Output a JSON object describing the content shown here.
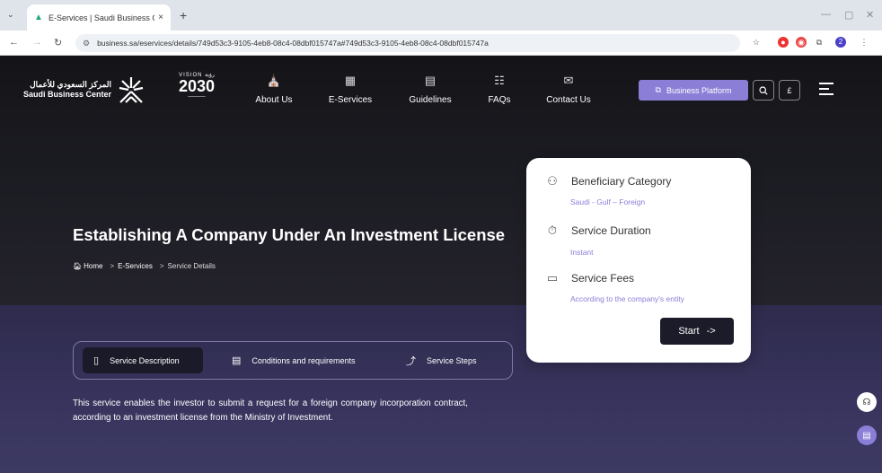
{
  "browser": {
    "tab_title": "E-Services | Saudi Business Cen",
    "tab_close": "×",
    "new_tab": "+",
    "url": "business.sa/eservices/details/749d53c3-9105-4eb8-08c4-08dbf015747a#749d53c3-9105-4eb8-08c4-08dbf015747a",
    "profile_initial": "2"
  },
  "header": {
    "logo_arabic": "المركز السعودي للأعمال",
    "logo_english": "Saudi Business Center",
    "vision_top": "VISION رؤية",
    "vision_year": "2030",
    "nav": [
      {
        "label": "About Us",
        "icon": "building-icon"
      },
      {
        "label": "E-Services",
        "icon": "monitor-icon"
      },
      {
        "label": "Guidelines",
        "icon": "book-icon"
      },
      {
        "label": "FAQs",
        "icon": "faq-icon"
      },
      {
        "label": "Contact Us",
        "icon": "contact-icon"
      }
    ],
    "business_platform": "Business Platform",
    "currency_symbol": "£"
  },
  "hero": {
    "title": "Establishing A Company Under An Investment License",
    "breadcrumb": {
      "home": "Home",
      "eservices": "E-Services",
      "details": "Service Details",
      "sep": ">"
    }
  },
  "card": {
    "beneficiary_title": "Beneficiary Category",
    "beneficiary_value": "Saudi - Gulf – Foreign",
    "duration_title": "Service Duration",
    "duration_value": "Instant",
    "fees_title": "Service Fees",
    "fees_value": "According to the company's entity",
    "start_label": "Start",
    "start_arrow": "->"
  },
  "tabs": {
    "description": "Service Description",
    "conditions": "Conditions and requirements",
    "steps": "Service Steps"
  },
  "description": "This service enables the investor to submit a request for a foreign company incorporation contract, according to an investment license from the Ministry of Investment.",
  "colors": {
    "accent": "#8a7ed6",
    "dark": "#1c1b29"
  }
}
